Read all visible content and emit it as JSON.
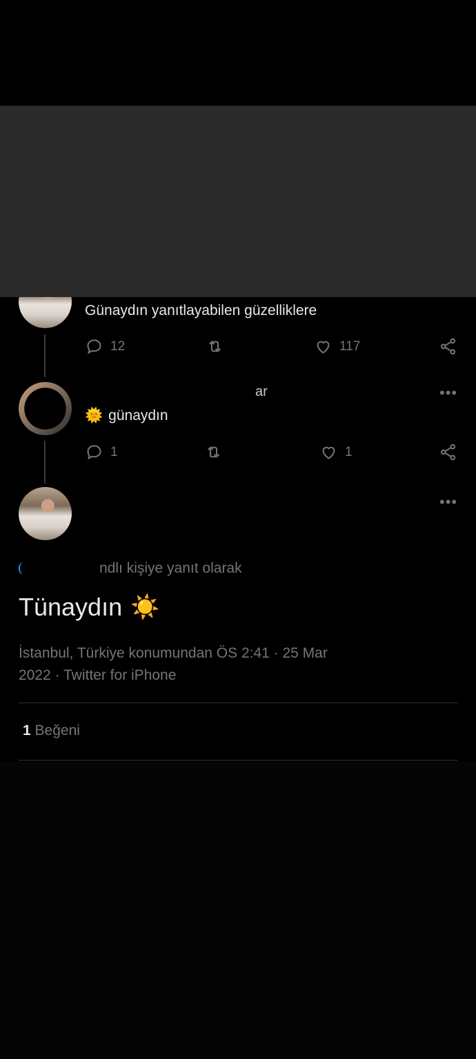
{
  "tweet1": {
    "text": "Günaydın yanıtlayabilen güzelliklere",
    "reply_count": "12",
    "like_count": "117"
  },
  "tweet2": {
    "header_fragment": "ar",
    "emoji": "🌞",
    "text": "günaydın",
    "reply_count": "1",
    "like_count": "1"
  },
  "main_tweet": {
    "reply_context": "ndlı kişiye yanıt olarak",
    "text": "Tünaydın",
    "emoji": "☀️",
    "meta_line1": "İstanbul, Türkiye konumundan ÖS 2:41 · 25 Mar",
    "meta_line2": "2022 · Twitter for iPhone",
    "likes_count": "1",
    "likes_label": "Beğeni"
  },
  "more_symbol": "•••",
  "colors": {
    "background": "#000000",
    "text": "#e7e9ea",
    "muted": "#71767b",
    "band": "#2a2a2a",
    "accent": "#1d9bf0"
  }
}
